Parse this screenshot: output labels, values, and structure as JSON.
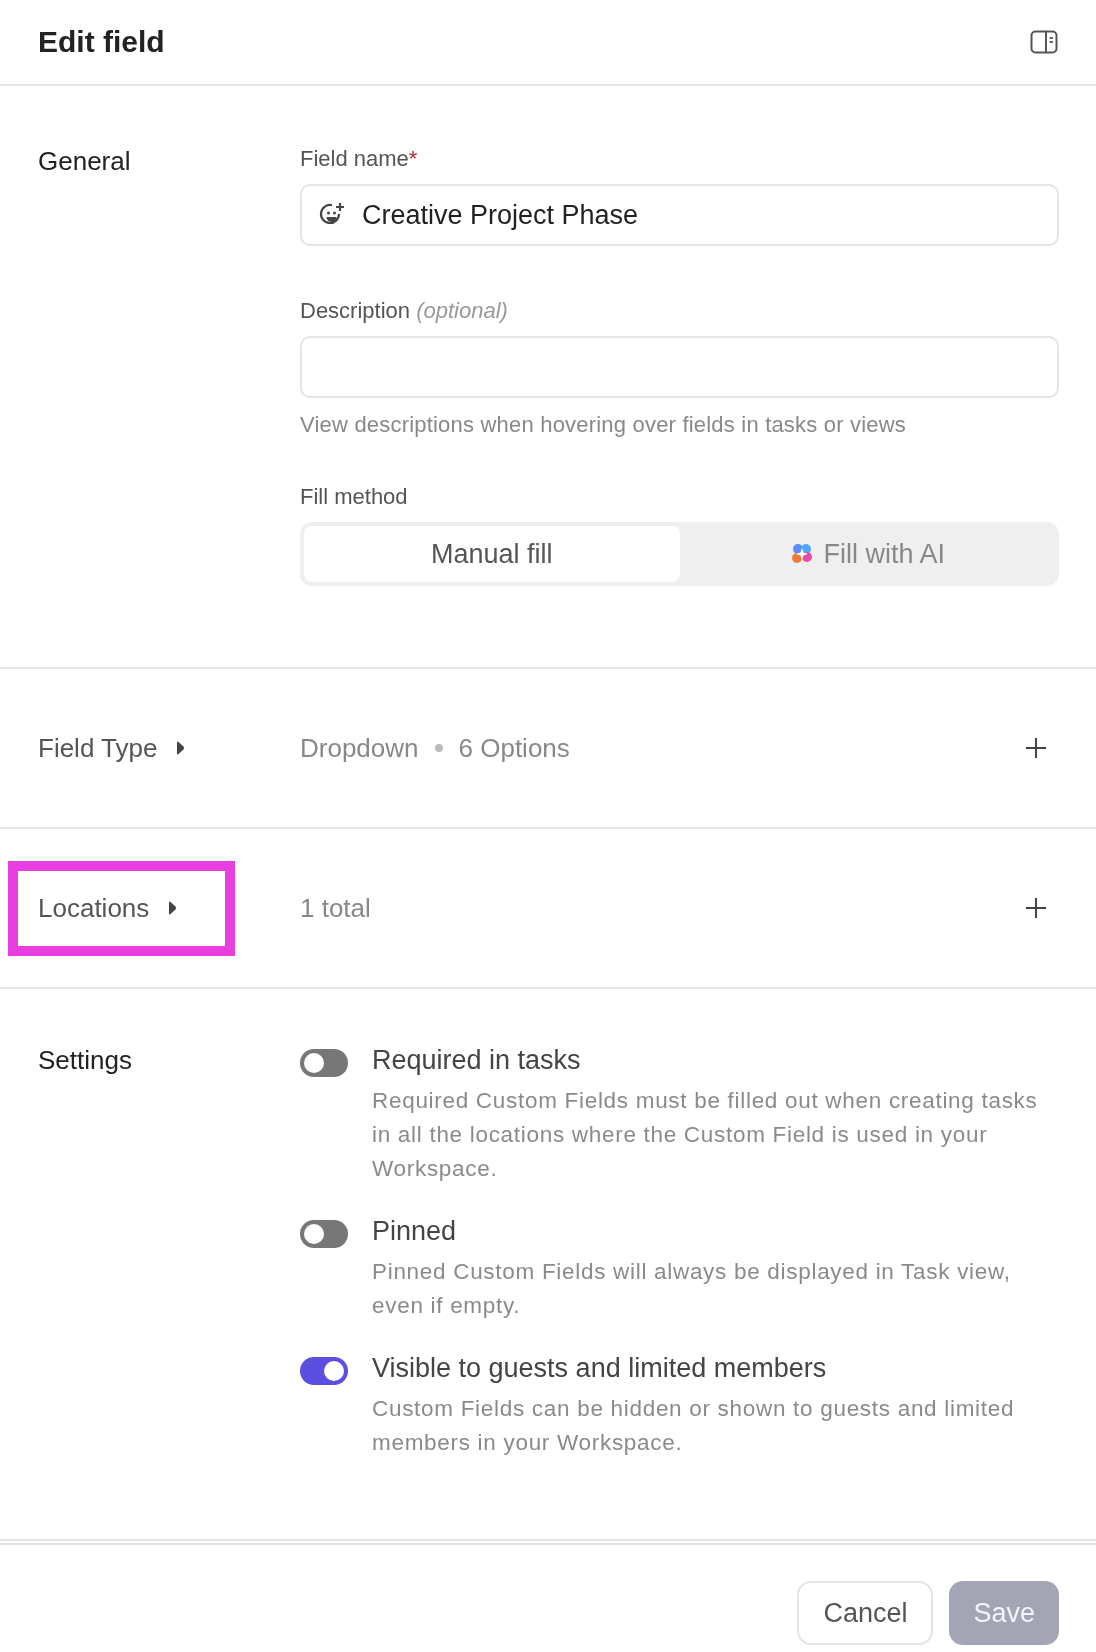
{
  "panel": {
    "title": "Edit field"
  },
  "general": {
    "title": "General",
    "field_name": {
      "label": "Field name",
      "required_mark": "*",
      "value": "Creative Project Phase"
    },
    "description": {
      "label": "Description",
      "optional_note": "(optional)",
      "help": "View descriptions when hovering over fields in tasks or views"
    },
    "fill_method": {
      "label": "Fill method",
      "options": [
        {
          "label": "Manual fill",
          "selected": true,
          "kind": "plain"
        },
        {
          "label": "Fill with AI",
          "selected": false,
          "kind": "ai"
        }
      ]
    }
  },
  "rows": [
    {
      "title": "Field Type",
      "highlighted": false,
      "values": [
        "Dropdown",
        "6 Options"
      ]
    },
    {
      "title": "Locations",
      "highlighted": true,
      "values": [
        "1 total"
      ]
    }
  ],
  "settings": {
    "title": "Settings",
    "items": [
      {
        "label": "Required in tasks",
        "on": false,
        "description": "Required Custom Fields must be filled out when creating tasks in all the locations where the Custom Field is used in your Workspace."
      },
      {
        "label": "Pinned",
        "on": false,
        "description": "Pinned Custom Fields will always be displayed in Task view, even if empty."
      },
      {
        "label": "Visible to guests and limited members",
        "on": true,
        "description": "Custom Fields can be hidden or shown to guests and limited members in your Workspace."
      }
    ]
  },
  "footer": {
    "cancel": "Cancel",
    "save": {
      "label": "Save",
      "disabled": true
    }
  }
}
